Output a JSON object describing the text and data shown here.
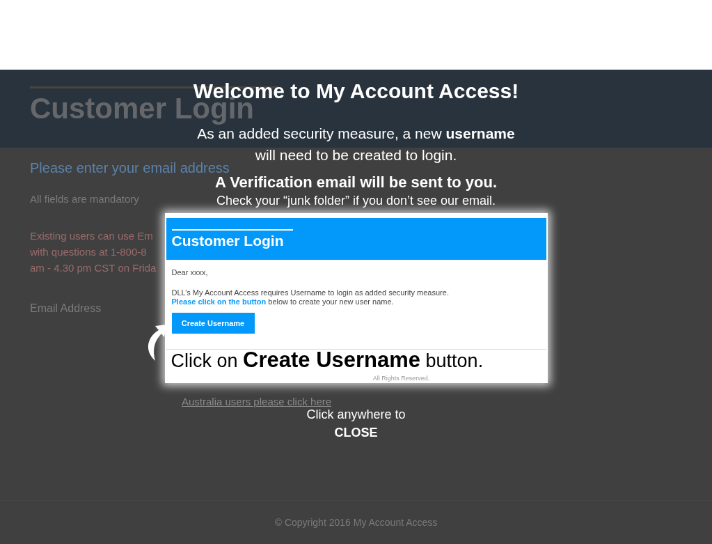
{
  "page": {
    "heading": "Customer Login",
    "prompt": "Please enter your email address",
    "note": "All fields are mandatory",
    "info_lines": [
      "Existing users can use Em",
      "with questions at 1-800-8",
      "am - 4.30 pm CST on Frida"
    ],
    "email_label": "Email Address",
    "australia_link": "Australia users please click here",
    "copyright": "© Copyright 2016 My Account Access"
  },
  "overlay": {
    "title": "Welcome to My Account Access!",
    "message_lines": [
      "As an added security measure, a new **username**",
      "will need to be created to login."
    ],
    "verification": "A Verification email will be sent to you.",
    "junk_note": "Check your “junk folder” if you don’t see our email.",
    "email": {
      "heading": "Customer Login",
      "greeting": "Dear xxxx,",
      "body": "DLL’s My Account Access requires Username to login as added security measure.",
      "link": "Please click on the button",
      "link_rest": "below to create your new user name.",
      "button": "Create Username",
      "footer": "All Rights Reserved."
    },
    "caption": "Click on **Create Username** button.",
    "close_lines": [
      "Click anywhere to",
      "CLOSE"
    ]
  }
}
